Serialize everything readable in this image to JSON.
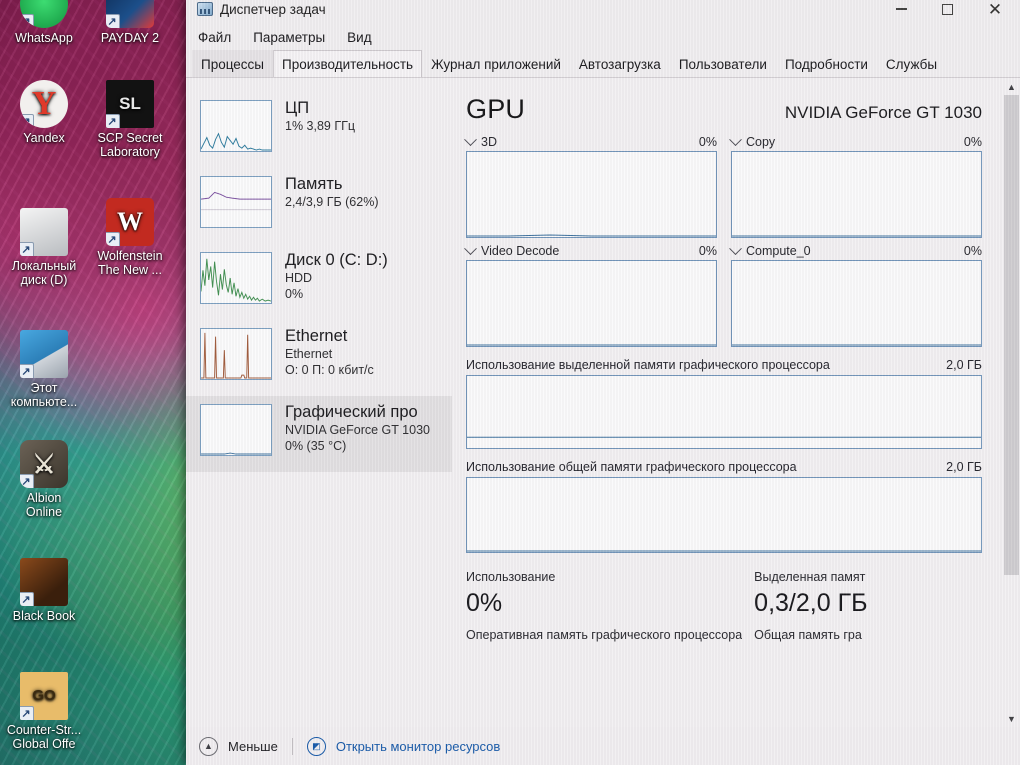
{
  "desktop": {
    "icons": [
      {
        "name": "whatsapp",
        "label": "WhatsApp",
        "label2": "",
        "glyph": "whatsapp-icon"
      },
      {
        "name": "payday2",
        "label": "PAYDAY 2",
        "label2": "",
        "glyph": "payday2-icon"
      },
      {
        "name": "yandex",
        "label": "Yandex",
        "label2": "",
        "glyph": "yandex-icon"
      },
      {
        "name": "scp",
        "label": "SCP Secret",
        "label2": "Laboratory",
        "glyph": "scp-icon"
      },
      {
        "name": "local-disk",
        "label": "Локальный",
        "label2": "диск (D)",
        "glyph": "drive-icon"
      },
      {
        "name": "wolfenstein",
        "label": "Wolfenstein",
        "label2": "The New ...",
        "glyph": "wolfenstein-icon"
      },
      {
        "name": "this-pc",
        "label": "Этот",
        "label2": "компьюте...",
        "glyph": "computer-icon"
      },
      {
        "name": "albion",
        "label": "Albion",
        "label2": "Online",
        "glyph": "albion-icon"
      },
      {
        "name": "black-book",
        "label": "Black Book",
        "label2": "",
        "glyph": "blackbook-icon"
      },
      {
        "name": "csgo",
        "label": "Counter-Str...",
        "label2": "Global Offe",
        "glyph": "csgo-icon"
      }
    ]
  },
  "window": {
    "title": "Диспетчер задач",
    "minimize_label": "Свернуть",
    "maximize_label": "Развернуть",
    "close_label": "Закрыть"
  },
  "menu": {
    "items": [
      "Файл",
      "Параметры",
      "Вид"
    ]
  },
  "tabs": [
    {
      "label": "Процессы",
      "state": "normal"
    },
    {
      "label": "Производительность",
      "state": "active"
    },
    {
      "label": "Журнал приложений",
      "state": "normal"
    },
    {
      "label": "Автозагрузка",
      "state": "normal"
    },
    {
      "label": "Пользователи",
      "state": "normal"
    },
    {
      "label": "Подробности",
      "state": "normal"
    },
    {
      "label": "Службы",
      "state": "normal"
    }
  ],
  "resources": [
    {
      "key": "cpu",
      "title": "ЦП",
      "line1": "1% 3,89 ГГц",
      "line2": "",
      "color": "#2a7a9c",
      "selected": false
    },
    {
      "key": "memory",
      "title": "Память",
      "line1": "2,4/3,9 ГБ (62%)",
      "line2": "",
      "color": "#6a4a9c",
      "selected": false
    },
    {
      "key": "disk0",
      "title": "Диск 0 (C: D:)",
      "line1": "HDD",
      "line2": "0%",
      "color": "#3f8f4f",
      "selected": false
    },
    {
      "key": "ethernet",
      "title": "Ethernet",
      "line1": "Ethernet",
      "line2": "О: 0 П: 0 кбит/с",
      "color": "#a05a3a",
      "selected": false
    },
    {
      "key": "gpu",
      "title": "Графический про",
      "line1": "NVIDIA GeForce GT 1030",
      "line2": "0% (35 °C)",
      "color": "#3a6f9c",
      "selected": true
    }
  ],
  "gpu": {
    "heading": "GPU",
    "device": "NVIDIA GeForce GT 1030",
    "engines": [
      {
        "name": "3D",
        "percent": "0%"
      },
      {
        "name": "Copy",
        "percent": "0%"
      },
      {
        "name": "Video Decode",
        "percent": "0%"
      },
      {
        "name": "Compute_0",
        "percent": "0%"
      }
    ],
    "dedicated_graph": {
      "label": "Использование выделенной памяти графического процессора",
      "max": "2,0 ГБ"
    },
    "shared_graph": {
      "label": "Использование общей памяти графического процессора",
      "max": "2,0 ГБ"
    },
    "stats": {
      "usage_label": "Использование",
      "usage_value": "0%",
      "usage_sub": "Оперативная память графического процессора",
      "dedicated_label": "Выделенная памят",
      "dedicated_value": "0,3/2,0 ГБ",
      "dedicated_sub": "Общая память гра"
    }
  },
  "statusbar": {
    "less_label": "Меньше",
    "resource_monitor_label": "Открыть монитор ресурсов"
  },
  "chart_data": [
    {
      "type": "line",
      "title": "ЦП",
      "ylabel": "%",
      "ylim": [
        0,
        100
      ],
      "values": [
        2,
        4,
        18,
        8,
        5,
        26,
        10,
        6,
        22,
        14,
        7,
        30,
        12,
        5,
        9,
        4,
        3,
        6,
        2,
        2,
        3,
        1,
        1,
        2,
        1
      ]
    },
    {
      "type": "line",
      "title": "Память",
      "ylabel": "ГБ",
      "ylim": [
        0,
        3.9
      ],
      "values": [
        2.3,
        2.3,
        2.35,
        2.55,
        2.5,
        2.45,
        2.42,
        2.4,
        2.4,
        2.4,
        2.4,
        2.4,
        2.4,
        2.4,
        2.4,
        2.4,
        2.4,
        2.4,
        2.4,
        2.4
      ]
    },
    {
      "type": "line",
      "title": "Диск 0 (C: D:)",
      "ylabel": "%",
      "ylim": [
        0,
        100
      ],
      "values": [
        40,
        85,
        30,
        95,
        55,
        70,
        40,
        90,
        35,
        25,
        60,
        30,
        20,
        45,
        15,
        12,
        28,
        10,
        8,
        14,
        6,
        5,
        9,
        4,
        3,
        5,
        2,
        2,
        1
      ]
    },
    {
      "type": "line",
      "title": "Ethernet",
      "ylabel": "кбит/с",
      "ylim": [
        0,
        100
      ],
      "values": [
        0,
        95,
        0,
        0,
        0,
        0,
        90,
        0,
        0,
        0,
        0,
        0,
        45,
        0,
        0,
        0,
        0,
        0,
        0,
        0,
        0,
        0,
        70,
        8,
        8,
        0,
        0,
        0,
        0,
        0
      ]
    },
    {
      "type": "line",
      "title": "Графический процессор",
      "ylabel": "%",
      "ylim": [
        0,
        100
      ],
      "values": [
        0,
        0,
        0,
        0,
        0,
        0,
        0,
        0,
        0,
        0,
        0,
        0,
        0,
        0,
        0,
        0,
        0,
        0,
        0,
        0
      ]
    },
    {
      "type": "line",
      "title": "3D",
      "ylabel": "%",
      "ylim": [
        0,
        100
      ],
      "values": [
        0,
        0,
        0,
        0,
        0,
        0,
        0,
        0,
        0,
        0,
        0,
        0,
        0,
        0,
        0,
        0,
        0,
        0,
        0,
        0
      ]
    },
    {
      "type": "line",
      "title": "Copy",
      "ylabel": "%",
      "ylim": [
        0,
        100
      ],
      "values": [
        0,
        0,
        0,
        0,
        0,
        0,
        0,
        0,
        0,
        0,
        0,
        0,
        0,
        0,
        0,
        0,
        0,
        0,
        0,
        0
      ]
    },
    {
      "type": "line",
      "title": "Video Decode",
      "ylabel": "%",
      "ylim": [
        0,
        100
      ],
      "values": [
        0,
        0,
        0,
        0,
        0,
        0,
        0,
        0,
        0,
        0,
        0,
        0,
        0,
        0,
        0,
        0,
        0,
        0,
        0,
        0
      ]
    },
    {
      "type": "line",
      "title": "Compute_0",
      "ylabel": "%",
      "ylim": [
        0,
        100
      ],
      "values": [
        0,
        0,
        0,
        0,
        0,
        0,
        0,
        0,
        0,
        0,
        0,
        0,
        0,
        0,
        0,
        0,
        0,
        0,
        0,
        0
      ]
    },
    {
      "type": "area",
      "title": "Использование выделенной памяти графического процессора",
      "ylabel": "ГБ",
      "ylim": [
        0,
        2.0
      ],
      "values": [
        0.3,
        0.3,
        0.3,
        0.3,
        0.3,
        0.3,
        0.3,
        0.3,
        0.3,
        0.3,
        0.3,
        0.3,
        0.3,
        0.3,
        0.3,
        0.3,
        0.3,
        0.3,
        0.3,
        0.3
      ]
    },
    {
      "type": "area",
      "title": "Использование общей памяти графического процессора",
      "ylabel": "ГБ",
      "ylim": [
        0,
        2.0
      ],
      "values": [
        0,
        0,
        0,
        0,
        0,
        0,
        0,
        0,
        0,
        0,
        0,
        0,
        0,
        0,
        0,
        0,
        0,
        0,
        0,
        0
      ]
    }
  ]
}
